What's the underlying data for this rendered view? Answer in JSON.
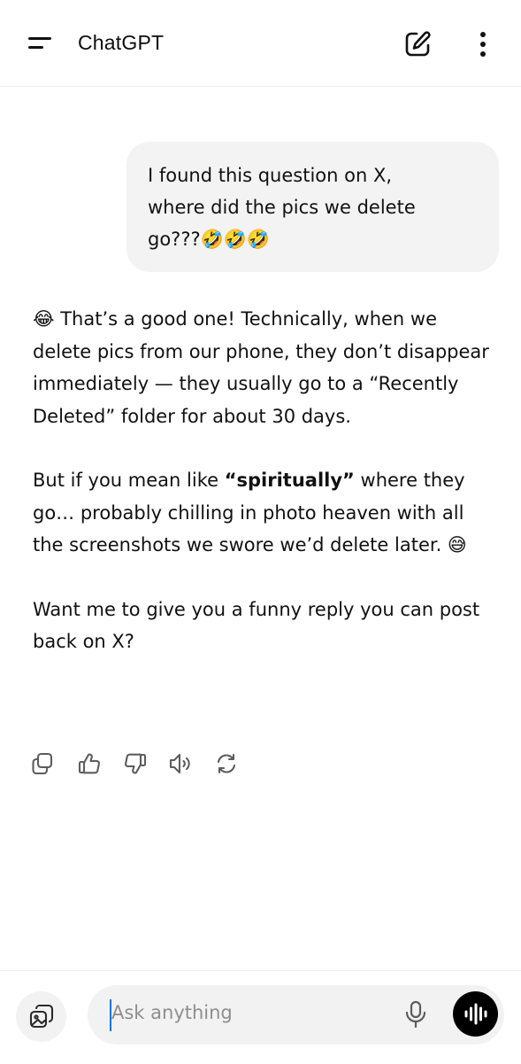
{
  "header": {
    "title": "ChatGPT"
  },
  "conversation": {
    "user_message": "I found this question on X,\nwhere did the pics we delete\ngo???🤣🤣🤣",
    "assistant": {
      "p1": "😂 That’s a good one! Technically, when we delete pics from our phone, they don’t disappear immediately — they usually go to a “Recently Deleted” folder for about 30 days.",
      "p2_before": "But if you mean like ",
      "p2_bold": "“spiritually”",
      "p2_after": " where they go… probably chilling in photo heaven with all the screenshots we swore we’d delete later. 😅",
      "p3": "Want me to give you a funny reply you can post back on X?"
    }
  },
  "composer": {
    "placeholder": "Ask anything"
  },
  "icons": {
    "menu": "menu-icon",
    "edit": "new-chat-edit-icon",
    "more": "more-vertical-icon",
    "copy": "copy-icon",
    "like": "thumbs-up-icon",
    "dislike": "thumbs-down-icon",
    "read_aloud": "speaker-icon",
    "regenerate": "regenerate-icon",
    "attach": "image-attach-icon",
    "mic": "mic-icon",
    "voice": "voice-waveform-icon"
  }
}
